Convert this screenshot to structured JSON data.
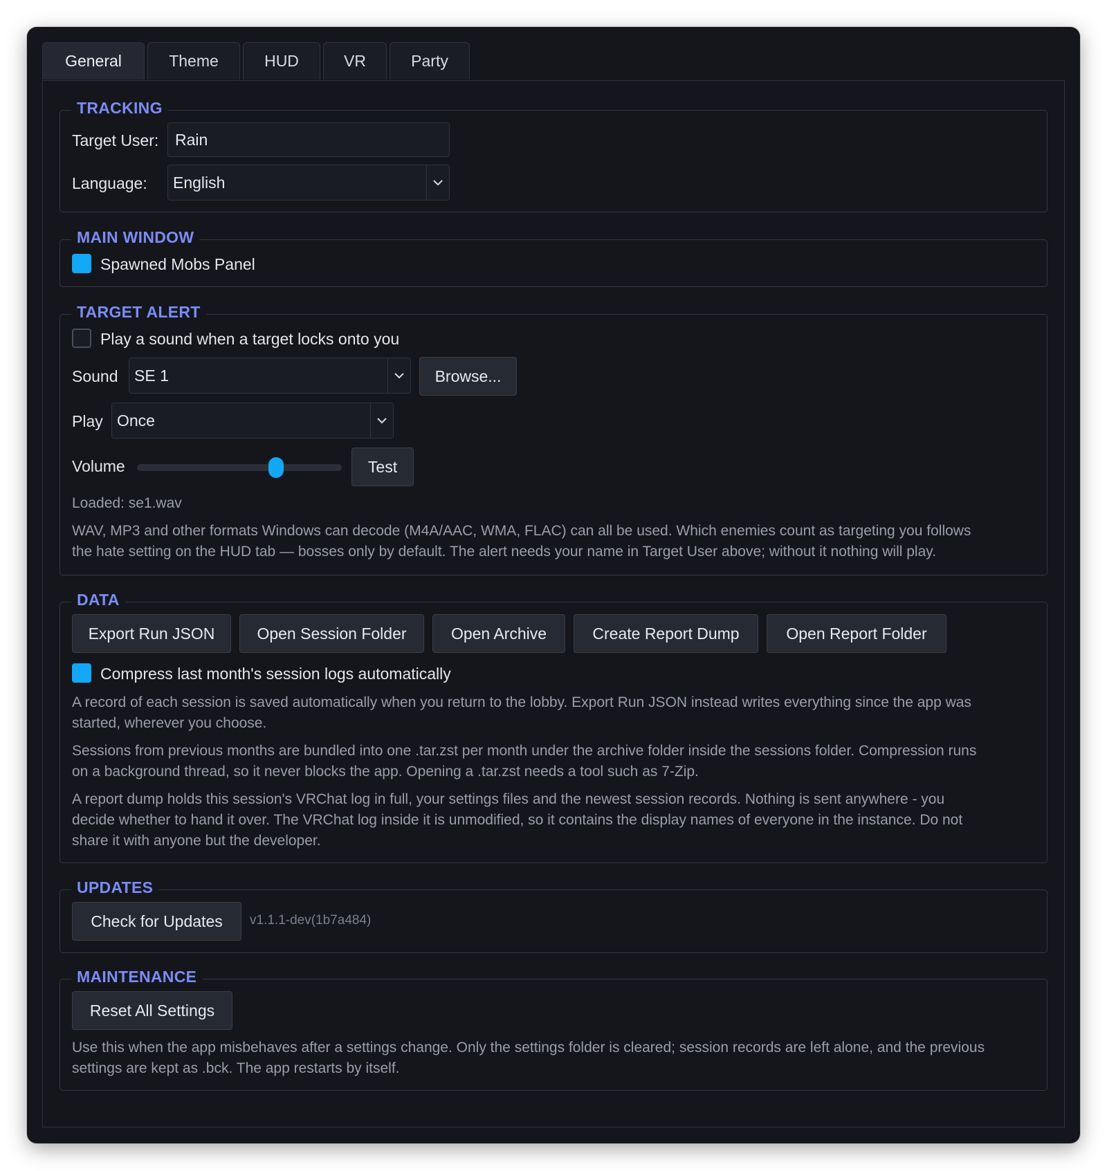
{
  "tabs": [
    {
      "label": "General",
      "active": true
    },
    {
      "label": "Theme",
      "active": false
    },
    {
      "label": "HUD",
      "active": false
    },
    {
      "label": "VR",
      "active": false
    },
    {
      "label": "Party",
      "active": false
    }
  ],
  "tracking": {
    "title": "TRACKING",
    "target_user_label": "Target User:",
    "target_user_value": "Rain",
    "language_label": "Language:",
    "language_value": "English"
  },
  "main_window": {
    "title": "MAIN WINDOW",
    "spawned_mobs_label": "Spawned Mobs Panel",
    "spawned_mobs_checked": true
  },
  "target_alert": {
    "title": "TARGET ALERT",
    "play_sound_label": "Play a sound when a target locks onto you",
    "play_sound_checked": false,
    "sound_label": "Sound",
    "sound_value": "SE 1",
    "browse_label": "Browse...",
    "play_label": "Play",
    "play_value": "Once",
    "volume_label": "Volume",
    "volume_fraction": 0.68,
    "test_label": "Test",
    "loaded_text": "Loaded: se1.wav",
    "hint_line1": "WAV, MP3 and other formats Windows can decode (M4A/AAC, WMA, FLAC) can all be used. Which enemies count as targeting you follows",
    "hint_line2": "the hate setting on the HUD tab — bosses only by default. The alert needs your name in Target User above; without it nothing will play."
  },
  "data": {
    "title": "DATA",
    "buttons": [
      "Export Run JSON",
      "Open Session Folder",
      "Open Archive",
      "Create Report Dump",
      "Open Report Folder"
    ],
    "compress_label": "Compress last month's session logs automatically",
    "compress_checked": true,
    "p1_l1": "A record of each session is saved automatically when you return to the lobby. Export Run JSON instead writes everything since the app was",
    "p1_l2": "started, wherever you choose.",
    "p2_l1": "Sessions from previous months are bundled into one .tar.zst per month under the archive folder inside the sessions folder. Compression runs",
    "p2_l2": "on a background thread, so it never blocks the app. Opening a .tar.zst needs a tool such as 7-Zip.",
    "p3_l1": "A report dump holds this session's VRChat log in full, your settings files and the newest session records. Nothing is sent anywhere - you",
    "p3_l2": "decide whether to hand it over. The VRChat log inside it is unmodified, so it contains the display names of everyone in the instance. Do not",
    "p3_l3": "share it with anyone but the developer."
  },
  "updates": {
    "title": "UPDATES",
    "check_label": "Check for Updates",
    "version": "v1.1.1-dev(1b7a484)"
  },
  "maintenance": {
    "title": "MAINTENANCE",
    "reset_label": "Reset All Settings",
    "hint_l1": "Use this when the app misbehaves after a settings change. Only the settings folder is cleared; session records are left alone, and the previous",
    "hint_l2": "settings are kept as .bck. The app restarts by itself."
  },
  "colors": {
    "accent": "#12a8f5",
    "section_title": "#7b8cf5",
    "window_bg": "#15161c"
  }
}
